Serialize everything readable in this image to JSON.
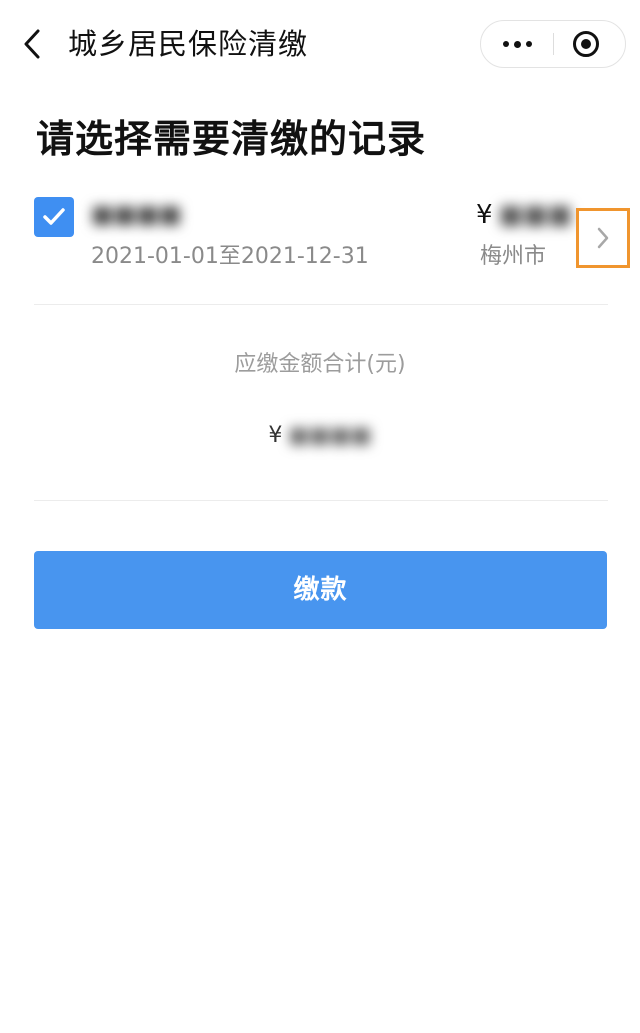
{
  "navbar": {
    "title": "城乡居民保险清缴",
    "back_icon": "chevron-left-icon",
    "more_icon": "more-dots-icon",
    "close_icon": "target-close-icon"
  },
  "page": {
    "title": "请选择需要清缴的记录"
  },
  "records": [
    {
      "selected": true,
      "name": "■■■■",
      "period": "2021-01-01至2021-12-31",
      "currency": "¥",
      "amount": "■■■",
      "city": "梅州市",
      "detail_icon": "chevron-right-icon"
    }
  ],
  "summary": {
    "label": "应缴金额合计(元)",
    "currency": "¥",
    "amount": "■■■■"
  },
  "actions": {
    "pay_label": "缴款"
  },
  "colors": {
    "primary": "#4895ef",
    "checkbox": "#3f8ff2",
    "highlight": "#f0952e",
    "muted_text": "#8a8a8a"
  }
}
